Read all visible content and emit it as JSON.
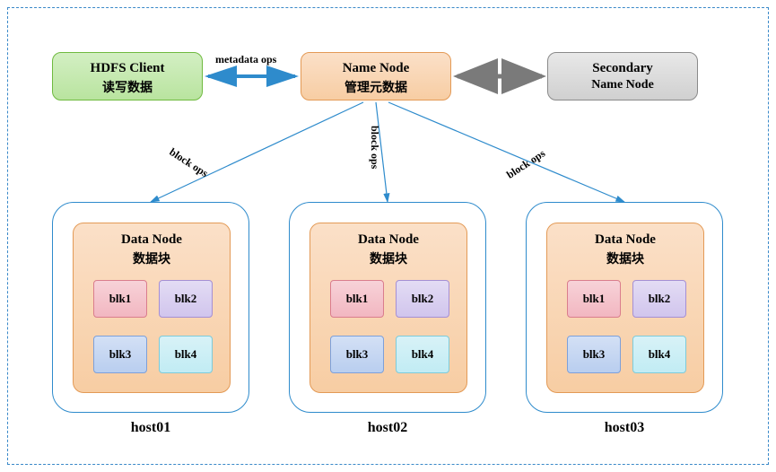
{
  "client": {
    "title": "HDFS Client",
    "subtitle": "读写数据"
  },
  "namenode": {
    "title": "Name Node",
    "subtitle": "管理元数据"
  },
  "secondary": {
    "title": "Secondary",
    "subtitle": "Name Node"
  },
  "edges": {
    "metadata": "metadata ops",
    "blockops": "block ops"
  },
  "datanode": {
    "title": "Data Node",
    "subtitle": "数据块"
  },
  "blocks": {
    "b1": "blk1",
    "b2": "blk2",
    "b3": "blk3",
    "b4": "blk4"
  },
  "hosts": {
    "h1": "host01",
    "h2": "host02",
    "h3": "host03"
  }
}
